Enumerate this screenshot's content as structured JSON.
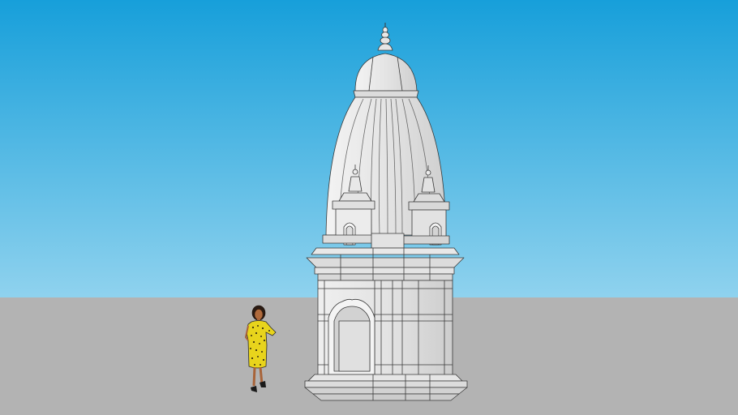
{
  "scene": {
    "sky_top_color": "#179fda",
    "sky_bottom_color": "#8fd2ee",
    "ground_color": "#b3b3b3",
    "model_color": "#e6e6e6",
    "edge_color": "#3a3a3a",
    "dress_color": "#e8d41c"
  }
}
